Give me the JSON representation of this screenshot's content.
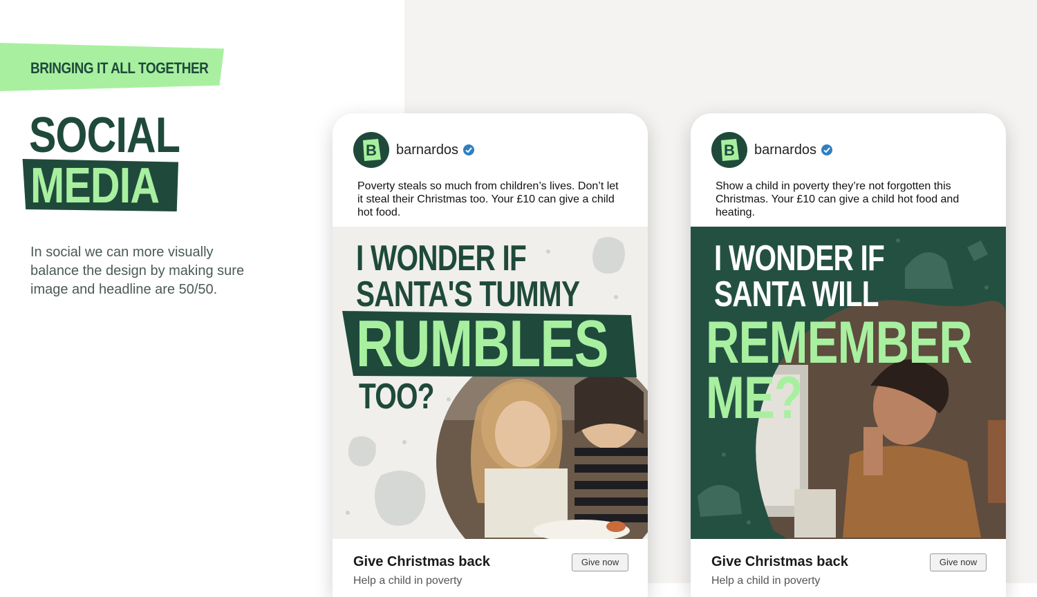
{
  "section": {
    "eyebrow": "BRINGING IT ALL TOGETHER",
    "title_line1": "SOCIAL",
    "title_line2": "MEDIA",
    "description": "In social we can more visually balance the design by making sure image and headline are 50/50."
  },
  "colors": {
    "brand_green": "#1f4a3b",
    "accent_green": "#a8f0a0",
    "panel_bg": "#f4f3f1",
    "verified_blue": "#2f7fc1"
  },
  "posts": [
    {
      "handle": "barnardos",
      "avatar_letter": "B",
      "caption": "Poverty steals so much from children’s lives. Don’t let it steal their Christmas too. Your £10 can give a child hot food.",
      "headline": [
        "I WONDER IF",
        "SANTA'S TUMMY",
        "RUMBLES",
        "TOO?"
      ],
      "image_desc_icon": "two-children-eating-photo",
      "cta_title": "Give Christmas back",
      "cta_sub": "Help a child in poverty",
      "button": "Give now"
    },
    {
      "handle": "barnardos",
      "avatar_letter": "B",
      "caption": "Show a child in poverty they’re not forgotten this Christmas. Your £10 can give a child hot food and heating.",
      "headline": [
        "I WONDER IF",
        "SANTA WILL",
        "REMEMBER",
        "ME?"
      ],
      "image_desc_icon": "child-at-window-photo",
      "cta_title": "Give Christmas back",
      "cta_sub": "Help a child in poverty",
      "button": "Give now"
    }
  ]
}
